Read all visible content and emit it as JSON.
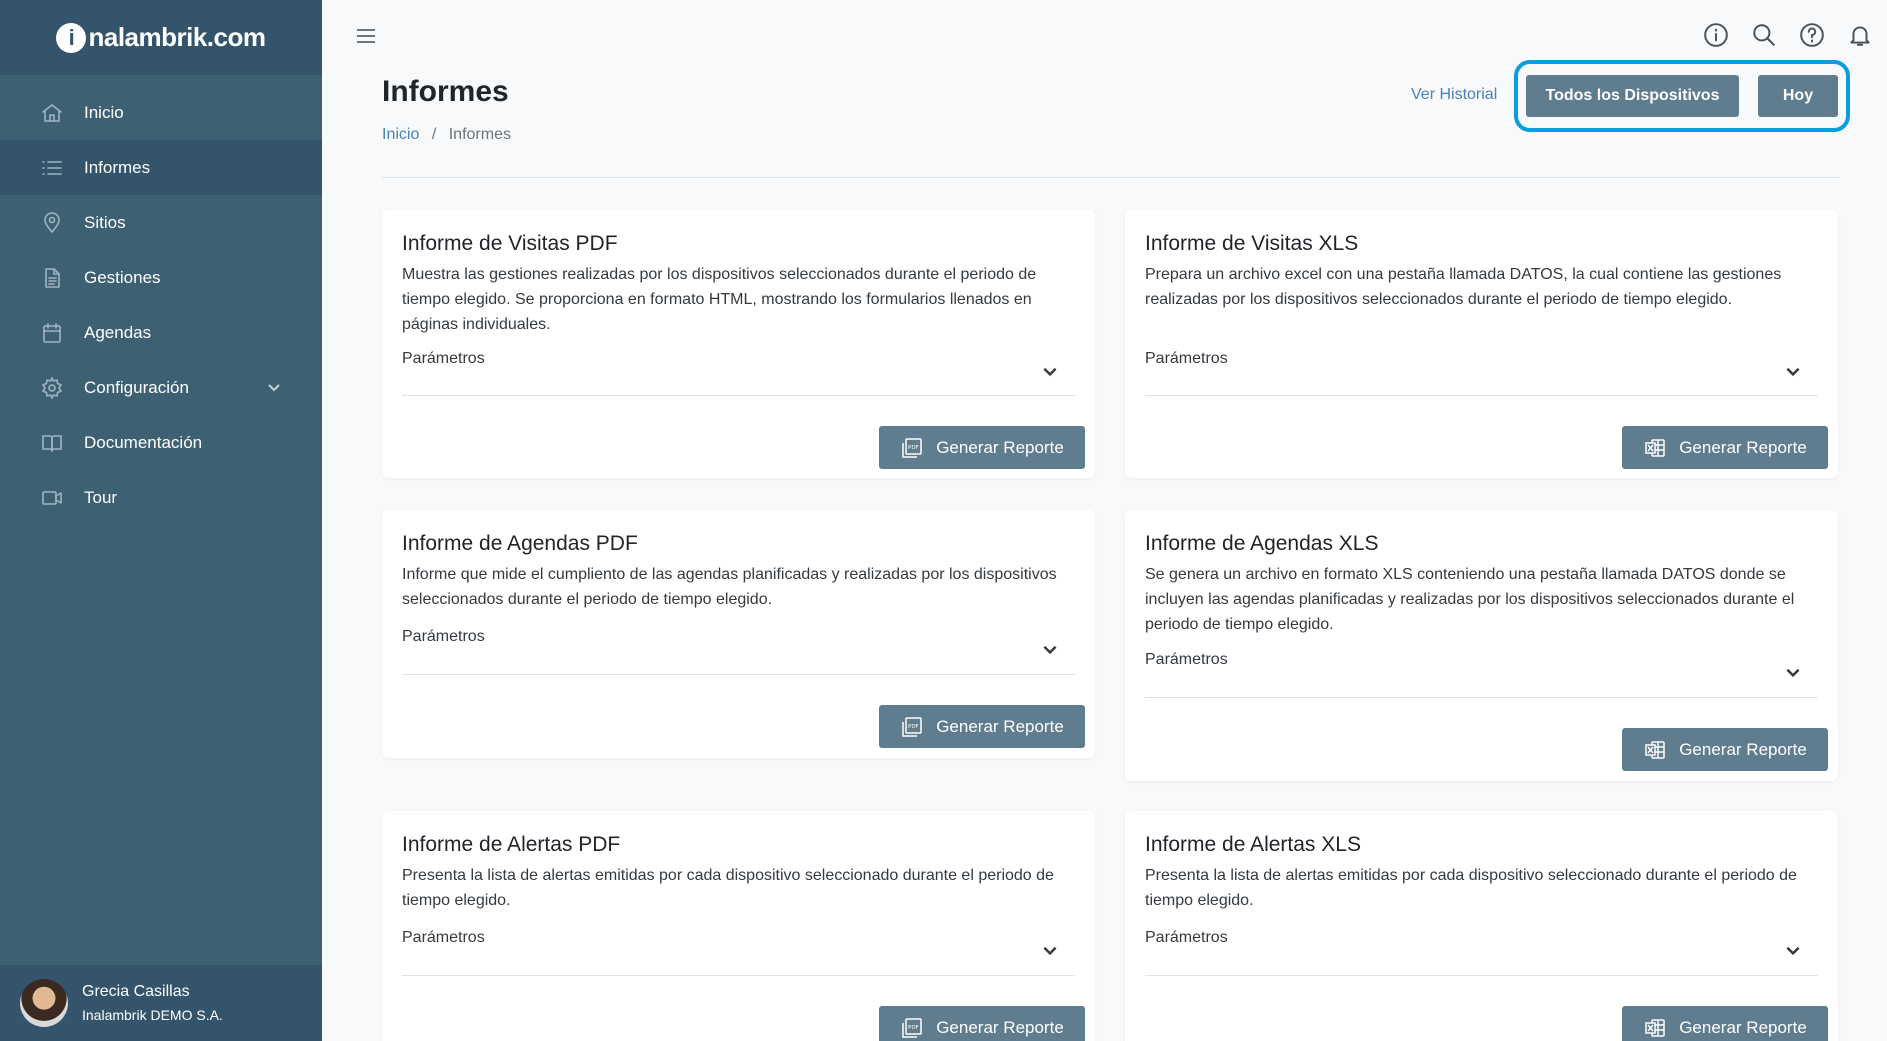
{
  "brand": {
    "logo_text": "nalambrik.com",
    "logo_letter": "i"
  },
  "sidebar": {
    "items": [
      {
        "label": "Inicio",
        "icon": "home-icon"
      },
      {
        "label": "Informes",
        "icon": "list-icon"
      },
      {
        "label": "Sitios",
        "icon": "map-pin-icon"
      },
      {
        "label": "Gestiones",
        "icon": "document-icon"
      },
      {
        "label": "Agendas",
        "icon": "calendar-icon"
      },
      {
        "label": "Configuración",
        "icon": "gear-icon"
      },
      {
        "label": "Documentación",
        "icon": "book-icon"
      },
      {
        "label": "Tour",
        "icon": "video-icon"
      }
    ],
    "user": {
      "name": "Grecia Casillas",
      "org": "Inalambrik DEMO S.A."
    }
  },
  "header": {
    "title": "Informes",
    "breadcrumb": {
      "home": "Inicio",
      "separator": "/",
      "current": "Informes"
    },
    "ver_historial": "Ver Historial",
    "devices_button": "Todos los Dispositivos",
    "date_button": "Hoy"
  },
  "cards": [
    {
      "title": "Informe de Visitas PDF",
      "description": "Muestra las gestiones realizadas por los dispositivos seleccionados durante el periodo de tiempo elegido. Se proporciona en formato HTML, mostrando los formularios llenados en páginas individuales.",
      "params_label": "Parámetros",
      "button_label": "Generar Reporte",
      "icon": "pdf-icon"
    },
    {
      "title": "Informe de Visitas XLS",
      "description": "Prepara un archivo excel con una pestaña llamada DATOS, la cual contiene las gestiones realizadas por los dispositivos seleccionados durante el periodo de tiempo elegido.",
      "params_label": "Parámetros",
      "button_label": "Generar Reporte",
      "icon": "excel-icon"
    },
    {
      "title": "Informe de Agendas PDF",
      "description": "Informe que mide el cumpliento de las agendas planificadas y realizadas por los dispositivos seleccionados durante el periodo de tiempo elegido.",
      "params_label": "Parámetros",
      "button_label": "Generar Reporte",
      "icon": "pdf-icon"
    },
    {
      "title": "Informe de Agendas XLS",
      "description": "Se genera un archivo en formato XLS conteniendo una pestaña llamada DATOS donde se incluyen las agendas planificadas y realizadas por los dispositivos seleccionados durante el periodo de tiempo elegido.",
      "params_label": "Parámetros",
      "button_label": "Generar Reporte",
      "icon": "excel-icon"
    },
    {
      "title": "Informe de Alertas PDF",
      "description": "Presenta la lista de alertas emitidas por cada dispositivo seleccionado durante el periodo de tiempo elegido.",
      "params_label": "Parámetros",
      "button_label": "Generar Reporte",
      "icon": "pdf-icon"
    },
    {
      "title": "Informe de Alertas XLS",
      "description": "Presenta la lista de alertas emitidas por cada dispositivo seleccionado durante el periodo de tiempo elegido.",
      "params_label": "Parámetros",
      "button_label": "Generar Reporte",
      "icon": "excel-icon"
    }
  ],
  "colors": {
    "sidebar": "#3e6073",
    "sidebar_dark": "#33546a",
    "button": "#5f7d8f",
    "link": "#4a82b8",
    "highlight": "#0b9de0"
  }
}
